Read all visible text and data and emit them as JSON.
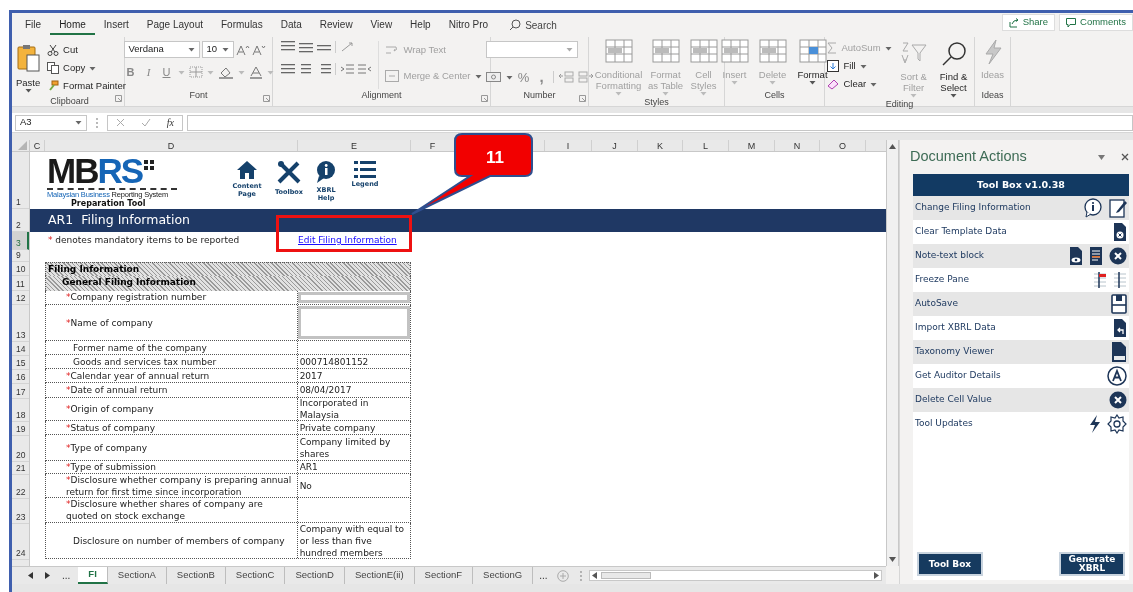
{
  "menu_tabs": [
    {
      "label": "File",
      "selected": false
    },
    {
      "label": "Home",
      "selected": true
    },
    {
      "label": "Insert",
      "selected": false
    },
    {
      "label": "Page Layout",
      "selected": false
    },
    {
      "label": "Formulas",
      "selected": false
    },
    {
      "label": "Data",
      "selected": false
    },
    {
      "label": "Review",
      "selected": false
    },
    {
      "label": "View",
      "selected": false
    },
    {
      "label": "Help",
      "selected": false
    },
    {
      "label": "Nitro Pro",
      "selected": false
    }
  ],
  "search": {
    "placeholder": "Search"
  },
  "share_button": "Share",
  "comments_button": "Comments",
  "ribbon": [
    {
      "title": "Clipboard",
      "items": [
        {
          "label": "Paste",
          "disabled": false
        },
        {
          "label": "Cut",
          "disabled": false
        },
        {
          "label": "Copy",
          "disabled": false
        },
        {
          "label": "Format Painter",
          "disabled": false
        }
      ]
    },
    {
      "title": "Font",
      "items": [
        {
          "kind": "combo",
          "value": "Verdana"
        },
        {
          "kind": "combo",
          "value": "10"
        },
        {
          "kind": "glyph",
          "label": "B"
        },
        {
          "kind": "glyph",
          "label": "I"
        },
        {
          "kind": "glyph",
          "label": "U"
        }
      ]
    },
    {
      "title": "Alignment",
      "items": [
        {
          "label": "Wrap Text",
          "disabled": true
        },
        {
          "label": "Merge & Center",
          "disabled": true
        }
      ]
    },
    {
      "title": "Number",
      "items": [
        {
          "kind": "glyph",
          "label": "%"
        },
        {
          "kind": "glyph",
          "label": ","
        }
      ]
    },
    {
      "title": "Styles",
      "items": [
        {
          "label": "Conditional Formatting",
          "disabled": true
        },
        {
          "label": "Format as Table",
          "disabled": true
        },
        {
          "label": "Cell Styles",
          "disabled": true
        }
      ]
    },
    {
      "title": "Cells",
      "items": [
        {
          "label": "Insert",
          "disabled": true
        },
        {
          "label": "Delete",
          "disabled": true
        },
        {
          "label": "Format",
          "disabled": false
        }
      ]
    },
    {
      "title": "Editing",
      "items": [
        {
          "label": "AutoSum",
          "disabled": true
        },
        {
          "label": "Fill",
          "disabled": false
        },
        {
          "label": "Clear",
          "disabled": false
        },
        {
          "label": "Sort & Filter",
          "disabled": true
        },
        {
          "label": "Find & Select",
          "disabled": false
        }
      ]
    },
    {
      "title": "Ideas",
      "items": [
        {
          "label": "Ideas",
          "disabled": true
        }
      ]
    }
  ],
  "formula_bar": {
    "name_box": "A3",
    "function_label": "fx"
  },
  "columns": [
    "C",
    "D",
    "E",
    "F",
    "I",
    "J",
    "K",
    "L",
    "M",
    "N",
    "O"
  ],
  "row_numbers": [
    {
      "label": "1",
      "selected": false
    },
    {
      "label": "2",
      "selected": false
    },
    {
      "label": "3",
      "selected": true
    },
    {
      "label": "9",
      "selected": false
    },
    {
      "label": "10",
      "selected": false
    },
    {
      "label": "11",
      "selected": false
    },
    {
      "label": "12",
      "selected": false
    },
    {
      "label": "13",
      "selected": false
    },
    {
      "label": "14",
      "selected": false
    },
    {
      "label": "15",
      "selected": false
    },
    {
      "label": "16",
      "selected": false
    },
    {
      "label": "17",
      "selected": false
    },
    {
      "label": "18",
      "selected": false
    },
    {
      "label": "19",
      "selected": false
    },
    {
      "label": "20",
      "selected": false
    },
    {
      "label": "21",
      "selected": false
    },
    {
      "label": "22",
      "selected": false
    },
    {
      "label": "23",
      "selected": false
    },
    {
      "label": "24",
      "selected": false
    }
  ],
  "logo": {
    "letters_dark": "MB",
    "letters_blue": "RS",
    "tagline_blue": "Malaysian Business",
    "tagline_dark": "Reporting System",
    "subtitle": "Preparation Tool"
  },
  "nav_icons": [
    {
      "label": "Content Page"
    },
    {
      "label": "Toolbox"
    },
    {
      "label": "XBRL Help"
    },
    {
      "label": "Legend"
    }
  ],
  "sheet_title": "AR1  Filing Information",
  "note": {
    "marker": "*",
    "text": "denotes mandatory items to be reported"
  },
  "edit_link": "Edit Filing Information",
  "callout": "11",
  "form": {
    "heading": "Filing Information",
    "subheading": "General Filing Information",
    "rows": [
      {
        "marker": "*",
        "label": "Company registration number",
        "kind": "input"
      },
      {
        "marker": "*",
        "label": "Name of company",
        "kind": "input"
      },
      {
        "label": "Former name of the company",
        "kind": "text"
      },
      {
        "label": "Goods and services tax number",
        "kind": "text",
        "value": "000714801152"
      },
      {
        "marker": "*",
        "label": "Calendar year of annual return",
        "kind": "text",
        "value": "2017"
      },
      {
        "marker": "*",
        "label": "Date of annual return",
        "kind": "text",
        "value": "08/04/2017"
      },
      {
        "marker": "*",
        "label": "Origin of company",
        "kind": "text",
        "value": "Incorporated in Malaysia"
      },
      {
        "marker": "*",
        "label": "Status of company",
        "kind": "text",
        "value": "Private company"
      },
      {
        "marker": "*",
        "label": "Type of company",
        "kind": "text",
        "value": "Company limited by shares"
      },
      {
        "marker": "*",
        "label": "Type of submission",
        "kind": "text",
        "value": "AR1"
      },
      {
        "marker": "*",
        "label": "Disclosure whether company is preparing annual return for first time since incorporation",
        "kind": "text",
        "value": "No"
      },
      {
        "marker": "*",
        "label": "Disclosure whether shares of company are quoted on stock exchange",
        "kind": "text"
      },
      {
        "label": "Disclosure on number of members of company",
        "kind": "text",
        "value": "Company with equal to or less than five hundred members"
      }
    ]
  },
  "sheet_tabs": {
    "more_left": "...",
    "tabs": [
      {
        "label": "FI",
        "selected": true
      },
      {
        "label": "SectionA",
        "selected": false
      },
      {
        "label": "SectionB",
        "selected": false
      },
      {
        "label": "SectionC",
        "selected": false
      },
      {
        "label": "SectionD",
        "selected": false
      },
      {
        "label": "SectionE(ii)",
        "selected": false
      },
      {
        "label": "SectionF",
        "selected": false
      },
      {
        "label": "SectionG",
        "selected": false
      }
    ],
    "more_right": "..."
  },
  "task_pane": {
    "title": "Document Actions",
    "toolbox_title": "Tool Box v1.0.38",
    "items": [
      {
        "label": "Change Filing Information"
      },
      {
        "label": "Clear Template Data"
      },
      {
        "label": "Note-text block"
      },
      {
        "label": "Freeze Pane"
      },
      {
        "label": "AutoSave"
      },
      {
        "label": "Import XBRL Data"
      },
      {
        "label": "Taxonomy Viewer"
      },
      {
        "label": "Get Auditor Details"
      },
      {
        "label": "Delete Cell Value"
      },
      {
        "label": "Tool Updates"
      }
    ],
    "buttons": [
      "Tool Box",
      "Generate XBRL"
    ]
  }
}
